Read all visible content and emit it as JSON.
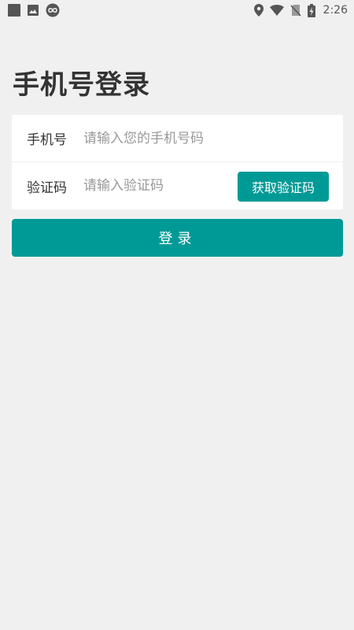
{
  "status_bar": {
    "time": "2:26",
    "left_icons": [
      "square-icon",
      "image-icon",
      "infinity-icon"
    ],
    "right_icons": [
      "location-icon",
      "wifi-icon",
      "no-sim-icon",
      "battery-charging-icon"
    ]
  },
  "page": {
    "title": "手机号登录"
  },
  "form": {
    "phone": {
      "label": "手机号",
      "placeholder": "请输入您的手机号码",
      "value": ""
    },
    "code": {
      "label": "验证码",
      "placeholder": "请输入验证码",
      "value": "",
      "get_code_label": "获取验证码"
    }
  },
  "login_button": {
    "label": "登录"
  },
  "colors": {
    "accent": "#009a96",
    "background": "#f0f0f0",
    "card": "#ffffff",
    "title": "#333333",
    "placeholder": "#999999"
  }
}
